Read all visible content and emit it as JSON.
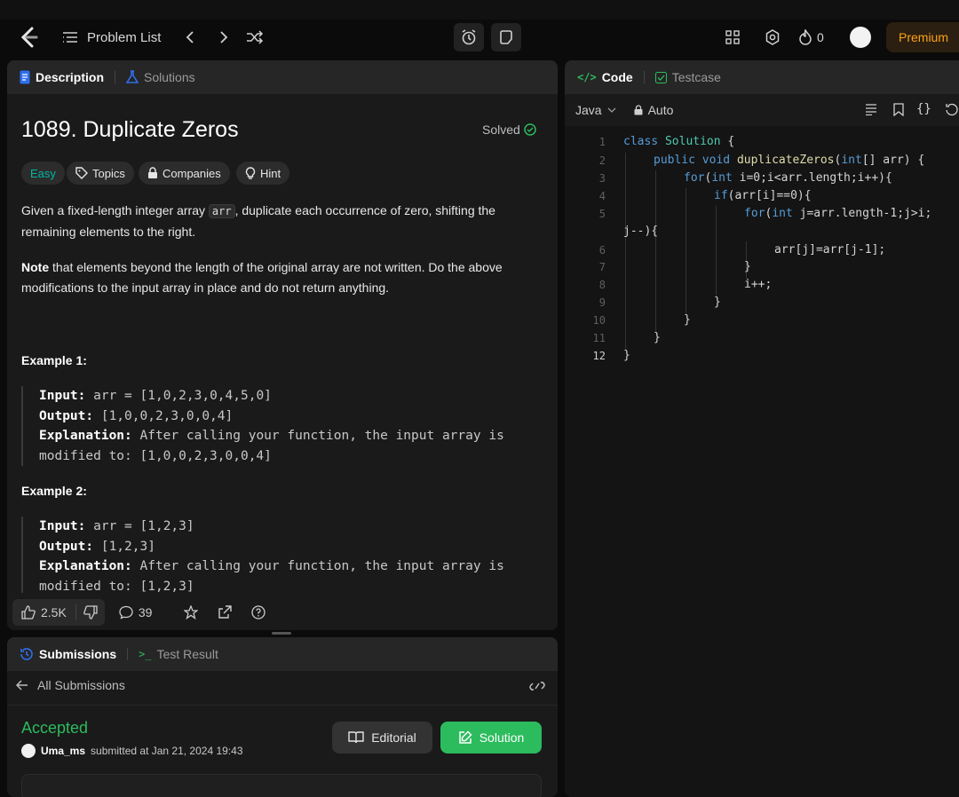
{
  "topbar": {
    "problem_list": "Problem List",
    "coins": "0",
    "premium": "Premium"
  },
  "description_panel": {
    "tabs": [
      "Description",
      "Solutions"
    ],
    "title": "1089. Duplicate Zeros",
    "status": "Solved",
    "tags": [
      "Easy",
      "Topics",
      "Companies",
      "Hint"
    ],
    "para1_a": "Given a fixed-length integer array ",
    "para1_code": "arr",
    "para1_b": ", duplicate each occurrence of zero, shifting the remaining elements to the right.",
    "para2_bold": "Note",
    "para2_rest": " that elements beyond the length of the original array are not written. Do the above modifications to the input array in place and do not return anything.",
    "examples": [
      {
        "heading": "Example 1:",
        "input_label": "Input:",
        "input": " arr = [1,0,2,3,0,4,5,0]",
        "output_label": "Output:",
        "output": " [1,0,0,2,3,0,0,4]",
        "explanation_label": "Explanation:",
        "explanation": " After calling your function, the input array is modified to: [1,0,0,2,3,0,0,4]"
      },
      {
        "heading": "Example 2:",
        "input_label": "Input:",
        "input": " arr = [1,2,3]",
        "output_label": "Output:",
        "output": " [1,2,3]",
        "explanation_label": "Explanation:",
        "explanation": " After calling your function, the input array is modified to: [1,2,3]"
      }
    ],
    "likes": "2.5K",
    "comments": "39"
  },
  "code_panel": {
    "tabs": [
      "Code",
      "Testcase"
    ],
    "language": "Java",
    "mode": "Auto",
    "line_numbers": [
      "1",
      "2",
      "3",
      "4",
      "5",
      "",
      "6",
      "7",
      "8",
      "9",
      "10",
      "11",
      "12"
    ]
  },
  "submissions_panel": {
    "tabs": [
      "Submissions",
      "Test Result"
    ],
    "back_label": "All Submissions",
    "result": "Accepted",
    "user": "Uma_ms",
    "submitted_text": "submitted at Jan 21, 2024 19:43",
    "editorial": "Editorial",
    "solution": "Solution"
  },
  "colors": {
    "accent": "#ffa116",
    "accepted": "#2cbb5d",
    "easy": "#00b8a3"
  }
}
